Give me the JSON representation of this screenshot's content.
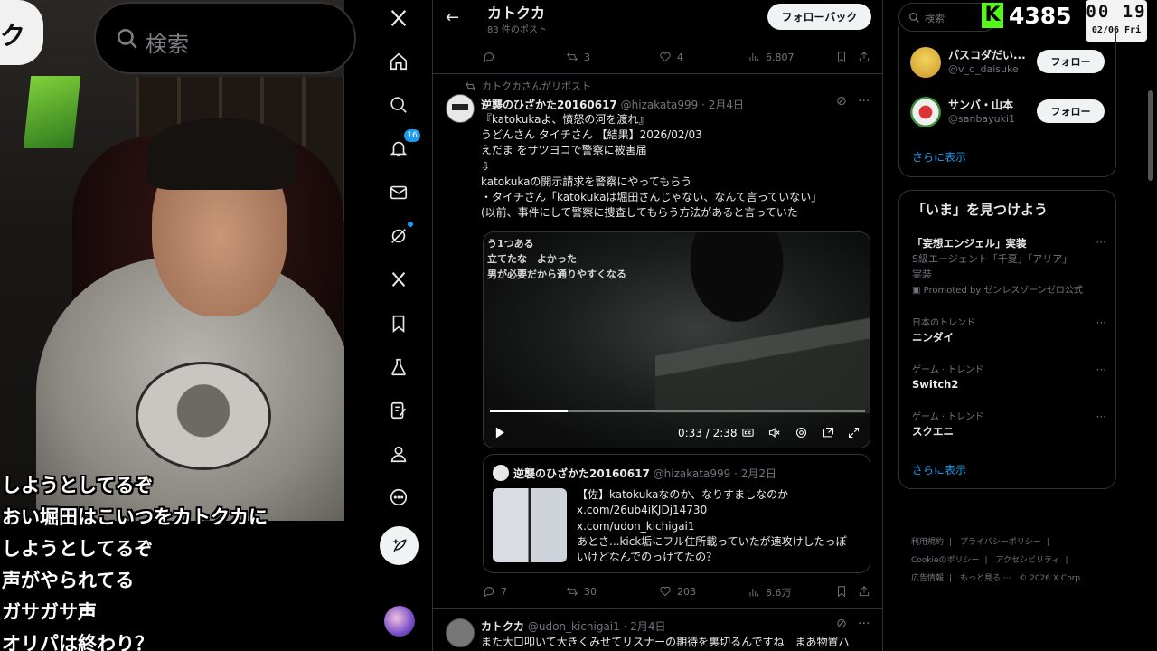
{
  "search_overlay": {
    "label": "検索"
  },
  "logo_fragment": "ク",
  "chat": [
    "しようとしてるぞ",
    "おい堀田はこいつをカトクカに",
    "しようとしてるぞ",
    "声がやられてる",
    "ガサガサ声",
    "オリパは終わり？"
  ],
  "nav": {
    "notifications_badge": "16",
    "icons": [
      "x-logo-icon",
      "home-icon",
      "search-icon",
      "notifications-icon",
      "messages-icon",
      "grok-icon",
      "premium-icon",
      "bookmarks-icon",
      "labs-icon",
      "compose-icon",
      "profile-icon",
      "more-icon"
    ]
  },
  "header": {
    "title": "カトクカ",
    "subtitle": "83 件のポスト",
    "follow_back": "フォローバック"
  },
  "prev_actions": {
    "reposts": "3",
    "likes": "4",
    "views": "6,807"
  },
  "tweet": {
    "repost_by": "カトクカさんがリポスト",
    "name": "逆襲のひざかた20160617",
    "handle": "@hizakata999",
    "date": "· 2月4日",
    "lines": [
      "『katokukaよ、憤怒の河を渡れ』",
      "うどんさん タイチさん 【結果】2026/02/03",
      "えだま をサツヨコで警察に被害届",
      "⇩",
      "katokukaの開示請求を警察にやってもらう",
      "・タイチさん「katokukaは堀田さんじゃない、なんて言っていない」",
      "(以前、事件にして警察に捜査してもらう方法があると言っていた"
    ],
    "video": {
      "captions": [
        "う1つある",
        "立てたな　よかった",
        "男が必要だから通りやすくなる"
      ],
      "time": "0:33 / 2:38",
      "progress": 0.208
    },
    "quote": {
      "name": "逆襲のひざかた20160617",
      "handle": "@hizakata999",
      "date": "· 2月2日",
      "lines": [
        "【佐】katokukaなのか、なりすましなのか",
        "x.com/26ub4iKJDj14730",
        "x.com/udon_kichigai1",
        "あとさ...kick垢にフル住所載っていたが速攻けしたっぽ",
        "いけどなんでのっけてたの？"
      ]
    },
    "actions": {
      "replies": "7",
      "reposts": "30",
      "likes": "203",
      "views": "8.6万"
    }
  },
  "next_tweet": {
    "name": "カトクカ",
    "handle": "@udon_kichigai1",
    "date": "· 2月4日",
    "text": "また大口叩いて大きくみせてリスナーの期待を裏切るんですね　まあ物置ハ"
  },
  "right": {
    "search_placeholder": "検索",
    "kick_viewers": "4385",
    "clock_time": "00 19",
    "clock_date": "02/06 Fri",
    "who_to_follow": [
      {
        "name": "パスコダだい...",
        "handle": "@v_d_daisuke",
        "button": "フォロー"
      },
      {
        "name": "サンバ・山本",
        "handle": "@sanbayuki1",
        "button": "フォロー"
      }
    ],
    "show_more": "さらに表示",
    "trends_title": "「いま」を見つけよう",
    "trends": [
      {
        "category": "",
        "title": "「妄想エンジェル」実装",
        "desc": "S級エージェント「千夏」「アリア」",
        "desc2": "実装",
        "promo": "Promoted by ゼンレスゾーンゼロ公式"
      },
      {
        "category": "日本のトレンド",
        "title": "ニンダイ"
      },
      {
        "category": "ゲーム · トレンド",
        "title": "Switch2"
      },
      {
        "category": "ゲーム · トレンド",
        "title": "スクエニ"
      }
    ],
    "trends_more": "さらに表示",
    "footer": [
      "利用規約",
      "|",
      "プライバシーポリシー",
      "|",
      "Cookieのポリシー",
      "|",
      "アクセシビリティ",
      "|",
      "広告情報",
      "|",
      "もっと見る ···",
      "© 2026 X Corp."
    ]
  }
}
